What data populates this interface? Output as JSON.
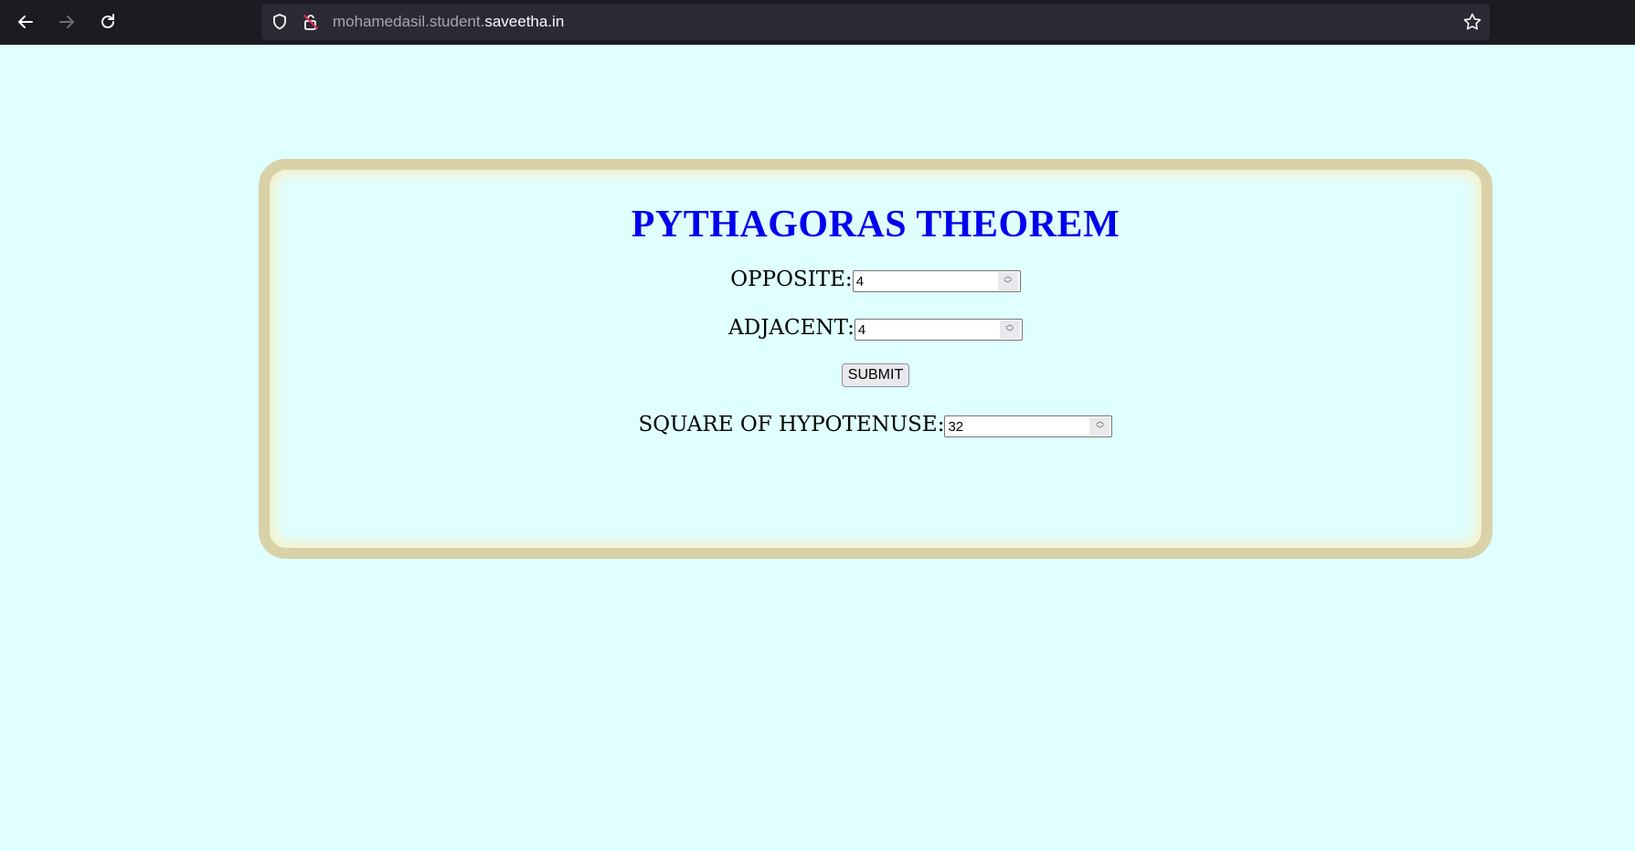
{
  "browser": {
    "url_prefix": "mohamedasil.student.",
    "url_domain": "saveetha.in"
  },
  "page": {
    "title": "PYTHAGORAS THEOREM",
    "opposite_label": "OPPOSITE:",
    "opposite_value": "4",
    "adjacent_label": "ADJACENT:",
    "adjacent_value": "4",
    "submit_label": "SUBMIT",
    "hypotenuse_label": "SQUARE OF HYPOTENUSE:",
    "hypotenuse_value": "32"
  },
  "colors": {
    "page_background": "#e0ffff",
    "title": "#0000ee",
    "card_border": "#d9d1a8",
    "toolbar": "#1c1b22"
  },
  "icons": [
    "back-arrow-icon",
    "forward-arrow-icon",
    "reload-icon",
    "shield-icon",
    "lock-icon",
    "star-icon"
  ]
}
